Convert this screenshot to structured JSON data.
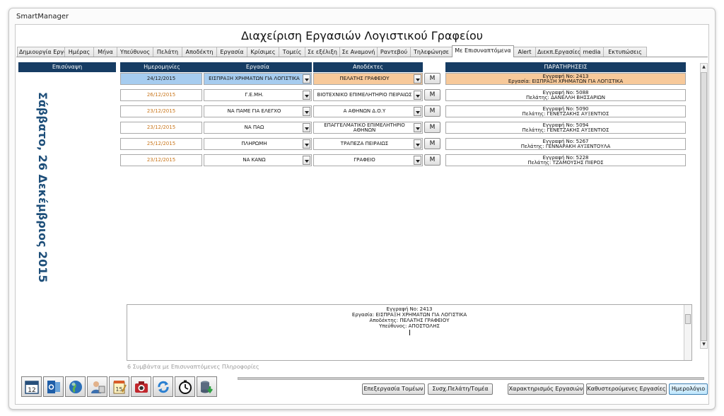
{
  "window": {
    "title": "SmartManager"
  },
  "page_title": "Διαχείριση Εργασιών Λογιστικού Γραφείου",
  "tabs": [
    {
      "label": "Δημιουργία Εργασιών",
      "w": 68
    },
    {
      "label": "Ημέρας",
      "w": 42
    },
    {
      "label": "Μήνα",
      "w": 34
    },
    {
      "label": "Υπεύθυνος",
      "w": 52
    },
    {
      "label": "Πελάτη",
      "w": 42
    },
    {
      "label": "Αποδέκτη",
      "w": 50
    },
    {
      "label": "Εργασία",
      "w": 44
    },
    {
      "label": "Κρίσιμες",
      "w": 46
    },
    {
      "label": "Τομείς",
      "w": 38
    },
    {
      "label": "Σε εξέλιξη",
      "w": 50
    },
    {
      "label": "Σε Αναμονή",
      "w": 54
    },
    {
      "label": "Ραντεβού",
      "w": 48
    },
    {
      "label": "Τηλεφώνησε",
      "w": 60
    },
    {
      "label": "Με Επισυναπτόμενα",
      "w": 88
    },
    {
      "label": "Alert",
      "w": 32
    },
    {
      "label": "Διεκπ.Εργασίες",
      "w": 64
    },
    {
      "label": "media",
      "w": 34
    },
    {
      "label": "Εκτυπώσεις",
      "w": 62
    }
  ],
  "active_tab": "Με Επισυναπτόμενα",
  "columns": {
    "attachment": "Επισύναψη",
    "dates": "Ημερομηνίες",
    "work": "Εργασία",
    "recipients": "Αποδέκτες",
    "notes": "ΠΑΡΑΤΗΡΗΣΕΙΣ"
  },
  "current_date": "Σάββατο, 26 Δεκέμβριος 2015",
  "rows": [
    {
      "date": "24/12/2015",
      "work": "ΕΙΣΠΡΑΞΗ ΧΡΗΜΑΤΩΝ ΓΙΑ ΛΟΓΙΣΤΙΚΑ",
      "recipient": "ΠΕΛΑΤΗΣ ΓΡΑΦΕΙΟΥ",
      "m": "M",
      "note1": "Εγγραφή Νο: 2413",
      "note2": "Εργασία: ΕΙΣΠΡΑΞΗ ΧΡΗΜΑΤΩΝ ΓΙΑ ΛΟΓΙΣΤΙΚΑ",
      "selected": true
    },
    {
      "date": "26/12/2015",
      "work": "Γ.Ε.ΜΗ.",
      "recipient": "ΒΙΟΤΕΧΝΙΚΟ ΕΠΙΜΕΛΗΤΗΡΙΟ ΠΕΙΡΑΙΩΣ",
      "m": "M",
      "note1": "Εγγραφή Νο: 5088",
      "note2": "Πελάτης: ΔΑΝΕΛΛΗ ΒΗΣΣΑΡΙΩΝ",
      "selected": false
    },
    {
      "date": "23/12/2015",
      "work": "ΝΑ ΠΑΜΕ ΓΙΑ ΕΛΕΓΧΟ",
      "recipient": "Α ΑΘΗΝΩΝ Δ.Ο.Υ",
      "m": "M",
      "note1": "Εγγραφή Νο: 5090",
      "note2": "Πελάτης: ΓΕΝΕΤΖΑΚΗΣ ΑΥΞΕΝΤΙΟΣ",
      "selected": false
    },
    {
      "date": "23/12/2015",
      "work": "ΝΑ ΠΑΩ",
      "recipient": "ΕΠΑΓΓΕΛΜΑΤΙΚΟ ΕΠΙΜΕΛΗΤΗΡΙΟ ΑΘΗΝΩΝ",
      "m": "M",
      "note1": "Εγγραφή Νο: 5094",
      "note2": "Πελάτης: ΓΕΝΕΤΖΑΚΗΣ ΑΥΞΕΝΤΙΟΣ",
      "selected": false
    },
    {
      "date": "25/12/2015",
      "work": "ΠΛΗΡΩΜΗ",
      "recipient": "ΤΡΑΠΕΖΑ ΠΕΙΡΑΙΩΣ",
      "m": "M",
      "note1": "Εγγραφή Νο: 5267",
      "note2": "Πελάτης: ΓΕΝΝΑΡΑΚΗ ΑΥΞΕΝΤΟΥΛΑ",
      "selected": false
    },
    {
      "date": "23/12/2015",
      "work": "ΝΑ ΚΑΝΩ",
      "recipient": "ΓΡΑΦΕΙΟ",
      "m": "M",
      "note1": "Εγγραφή Νο: 5228",
      "note2": "Πελάτης: ΤΖΑΜΟΥΣΗΣ ΠΙΕΡΟΣ",
      "selected": false
    }
  ],
  "detail": {
    "line1": "Εγγραφή Νο: 2413",
    "line2": "Εργασία: ΕΙΣΠΡΑΞΗ ΧΡΗΜΑΤΩΝ ΓΙΑ ΛΟΓΙΣΤΙΚΑ",
    "line3": "Αποδέκτης: ΠΕΛΑΤΗΣ ΓΡΑΦΕΙΟΥ",
    "line4": "Υπεύθυνος: ΑΠΟΣΤΟΛΗΣ"
  },
  "status_text": "6 Συμβάντα με Επισυναπτόμενες Πληροφορίες",
  "toolbar_icons": [
    "calendar-icon",
    "outlook-icon",
    "globe-icon",
    "users-icon",
    "notepad-icon",
    "camera-icon",
    "refresh-icon",
    "timer-icon",
    "database-export-icon"
  ],
  "calendar_day": "12",
  "notepad_day": "15",
  "buttons": {
    "edit_sectors": "Επεξεργασία Τομέων",
    "link_client_sector": "Συσχ.Πελάτη/Τομέα",
    "characterize": "Χαρακτηρισμός Εργασιών",
    "overdue": "Καθυστερούμενες Εργασίες",
    "calendar": "Ημερολόγιο"
  },
  "colors": {
    "header_bg": "#163c63",
    "selected_blue": "#a6ccef",
    "selected_orange": "#f7c99a",
    "date_orange": "#c9761b",
    "date_text_blue": "#1d4e79"
  }
}
